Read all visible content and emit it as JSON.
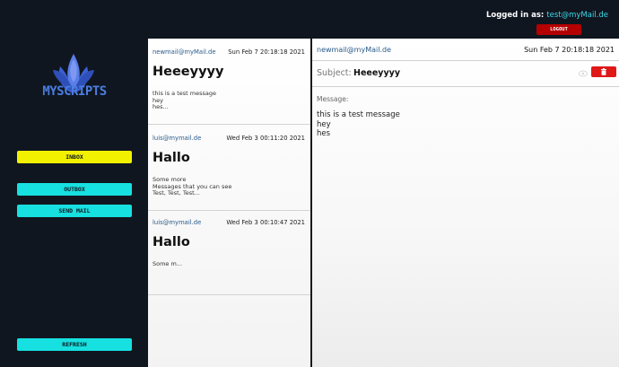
{
  "header": {
    "logged_in_label": "Logged in as:",
    "user_email": "test@myMail.de",
    "logout_label": "LOGOUT"
  },
  "sidebar": {
    "brand": "MYSCRIPTS",
    "inbox_label": "INBOX",
    "outbox_label": "OUTBOX",
    "send_label": "SEND MAIL",
    "refresh_label": "REFRESH"
  },
  "mails": [
    {
      "from": "newmail@myMail.de",
      "date": "Sun Feb 7 20:18:18 2021",
      "subject": "Heeeyyyy",
      "preview": [
        "this is a test message",
        "hey",
        "hes..."
      ]
    },
    {
      "from": "luis@mymail.de",
      "date": "Wed Feb 3 00:11:20 2021",
      "subject": "Hallo",
      "preview": [
        "Some more",
        "Messages that you can see",
        "Test, Test, Test..."
      ]
    },
    {
      "from": "luis@mymail.de",
      "date": "Wed Feb 3 00:10:47 2021",
      "subject": "Hallo",
      "preview": [
        "Some m..."
      ]
    }
  ],
  "detail": {
    "from": "newmail@myMail.de",
    "date": "Sun Feb 7 20:18:18 2021",
    "subject_label": "Subject:",
    "subject": "Heeeyyyy",
    "message_label": "Message:",
    "message_lines": [
      "this is a test message",
      "hey",
      "hes"
    ]
  },
  "colors": {
    "background": "#0f1620",
    "inbox_button": "#f2f200",
    "nav_button": "#17e0e0",
    "logout_button": "#b40000",
    "delete_button": "#e01818",
    "brand": "#4a7de0"
  },
  "icons": {
    "logo": "flower-logo-icon",
    "view": "eye-icon",
    "delete": "trash-icon"
  }
}
